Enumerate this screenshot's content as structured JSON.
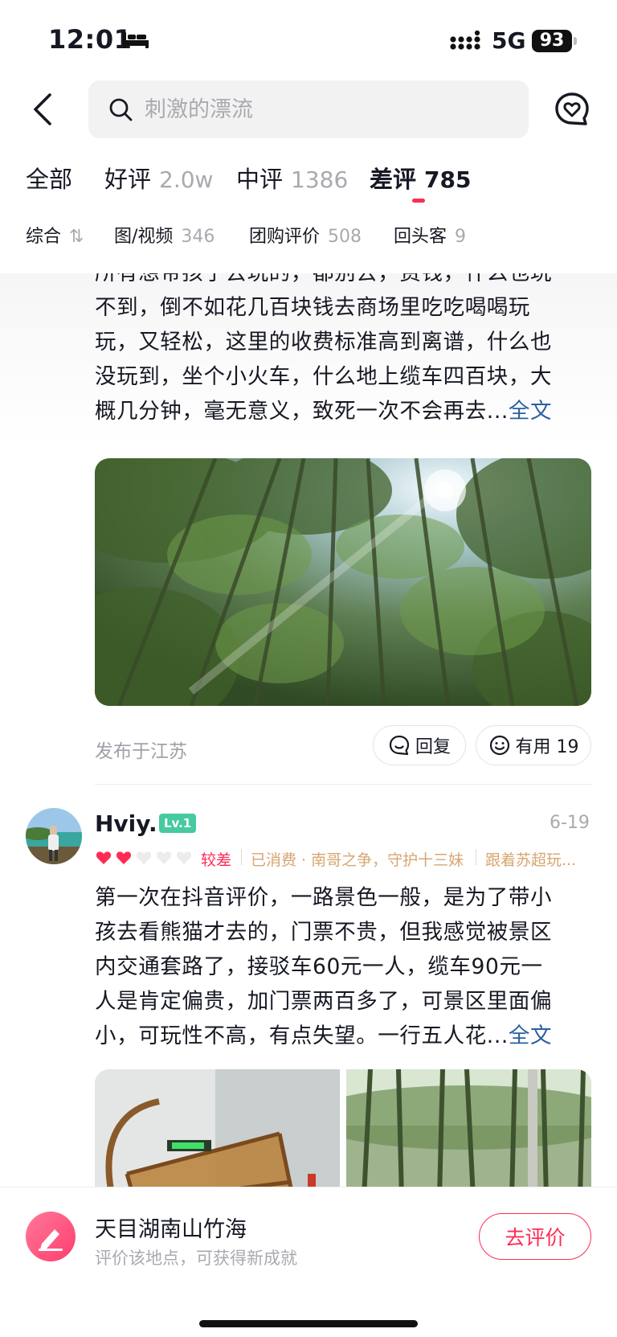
{
  "status_bar": {
    "time": "12:01",
    "network": "5G",
    "battery": "93"
  },
  "search": {
    "placeholder": "刺激的漂流"
  },
  "tabs": [
    {
      "label": "全部",
      "count": ""
    },
    {
      "label": "好评",
      "count": "2.0w"
    },
    {
      "label": "中评",
      "count": "1386"
    },
    {
      "label": "差评",
      "count": "785"
    }
  ],
  "active_tab": "差评",
  "filters": [
    {
      "label": "综合",
      "count": "⇅"
    },
    {
      "label": "图/视频",
      "count": "346"
    },
    {
      "label": "团购评价",
      "count": "508"
    },
    {
      "label": "回头客",
      "count": "9"
    }
  ],
  "reviews": [
    {
      "lines": [
        "所有想带孩子去玩的，都别去，费钱，什么也玩",
        "不到，倒不如花几百块钱去商场里吃吃喝喝玩",
        "玩，又轻松，这里的收费标准高到离谱，什么也",
        "没玩到，坐个小火车，什么地上缆车四百块，大",
        "概几分钟，毫无意义，致死一次不会再去..."
      ],
      "full_text_link": "全文",
      "location": "发布于江苏",
      "reply_label": "回复",
      "useful_label": "有用 19"
    },
    {
      "username": "Hviy..",
      "level": "Lv.1",
      "date": "6-19",
      "rating": {
        "filled_hearts": 2,
        "total_hearts": 5
      },
      "rating_label": "较差",
      "meta": [
        "已消费 · 南哥之争，守护十三妹",
        "跟着苏超玩..."
      ],
      "lines": [
        "第一次在抖音评价，一路景色一般，是为了带小",
        "孩去看熊猫才去的，门票不贵，但我感觉被景区",
        "内交通套路了，接驳车60元一人，缆车90元一",
        "人是肯定偏贵，加门票两百多了，可景区里面偏",
        "小，可玩性不高，有点失望。一行五人花..."
      ],
      "full_text_link": "全文"
    }
  ],
  "bottom_bar": {
    "place_name": "天目湖南山竹海",
    "subtitle": "评价该地点，可获得新成就",
    "review_button": "去评价"
  },
  "colors": {
    "accent": "#fe2c55",
    "link": "#2a5f9e",
    "muted": "#a9aab0"
  }
}
